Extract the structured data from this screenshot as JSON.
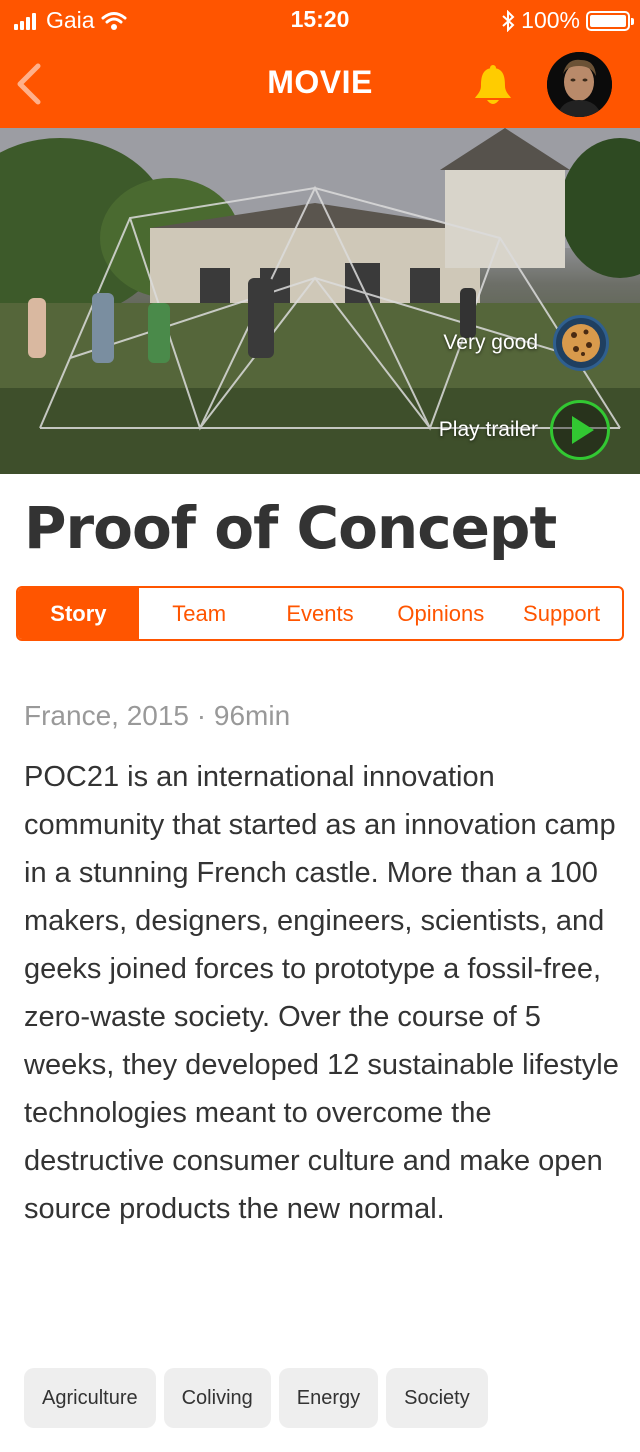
{
  "status_bar": {
    "carrier": "Gaia",
    "time": "15:20",
    "battery": "100%"
  },
  "nav": {
    "title": "MOVIE"
  },
  "hero": {
    "rating_label": "Very good",
    "trailer_label": "Play trailer"
  },
  "movie": {
    "title": "Proof of Concept",
    "meta": "France, 2015 · 96min",
    "story": "POC21 is an international innovation community that started as an innovation camp in a stunning French castle. More than a 100 makers, designers, engineers, scientists, and geeks joined forces to prototype a fossil-free, zero-waste society. Over the course of 5 weeks, they developed 12 sustainable lifestyle technologies meant to overcome the destructive consumer culture and make open source products the new normal."
  },
  "tabs": [
    {
      "label": "Story",
      "active": true
    },
    {
      "label": "Team",
      "active": false
    },
    {
      "label": "Events",
      "active": false
    },
    {
      "label": "Opinions",
      "active": false
    },
    {
      "label": "Support",
      "active": false
    }
  ],
  "tags": [
    "Agriculture",
    "Coliving",
    "Energy",
    "Society"
  ],
  "colors": {
    "accent": "#ff5500",
    "bell": "#ffcc00",
    "play": "#32c832"
  },
  "icons": {
    "back": "back-chevron-icon",
    "bell": "bell-icon",
    "rating": "cookie-icon",
    "play": "play-icon"
  }
}
